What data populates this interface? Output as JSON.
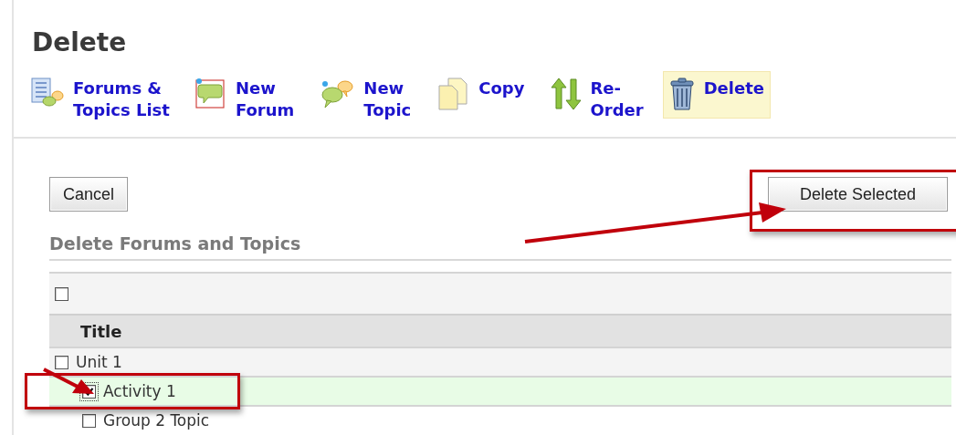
{
  "page": {
    "title": "Delete"
  },
  "toolbar": [
    {
      "kind": "list",
      "label": "Forums &\nTopics List",
      "selected": false
    },
    {
      "kind": "forum",
      "label": "New\nForum",
      "selected": false
    },
    {
      "kind": "topic",
      "label": "New\nTopic",
      "selected": false
    },
    {
      "kind": "copy",
      "label": "Copy",
      "selected": false
    },
    {
      "kind": "reorder",
      "label": "Re-\nOrder",
      "selected": false
    },
    {
      "kind": "trash",
      "label": "Delete",
      "selected": true
    }
  ],
  "buttons": {
    "cancel": "Cancel",
    "submit": "Delete Selected"
  },
  "section_title": "Delete Forums and Topics",
  "table": {
    "select_all": {
      "checked": false
    },
    "columns": [
      "Title"
    ],
    "rows": [
      {
        "title": "Unit 1",
        "checked": false,
        "selected": false,
        "children": [
          {
            "title": "Activity 1",
            "checked": true,
            "selected": true
          },
          {
            "title": "Group 2 Topic",
            "checked": false,
            "selected": false
          }
        ]
      }
    ]
  }
}
